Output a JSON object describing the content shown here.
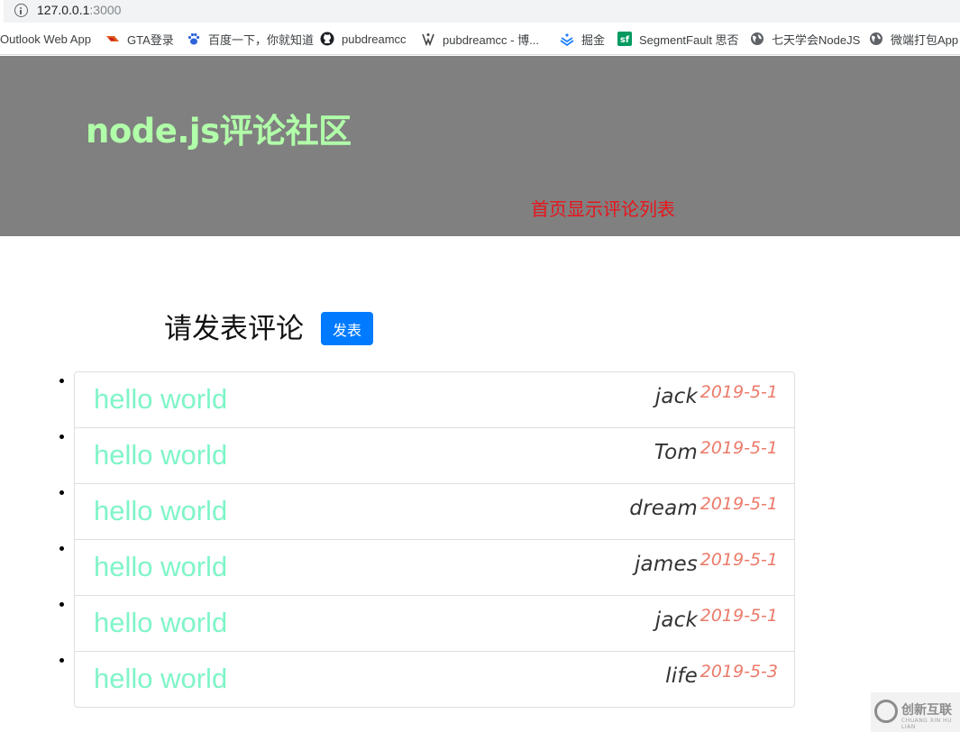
{
  "browser": {
    "url_host": "127.0.0.1",
    "url_port": ":3000",
    "bookmarks": [
      {
        "label": "Outlook Web App",
        "icon": "none"
      },
      {
        "label": "GTA登录",
        "icon": "gta-icon"
      },
      {
        "label": "百度一下，你就知道",
        "icon": "baidu-paw-icon"
      },
      {
        "label": "pubdreamcc",
        "icon": "github-icon"
      },
      {
        "label": "pubdreamcc - 博...",
        "icon": "cnblogs-icon"
      },
      {
        "label": "掘金",
        "icon": "juejin-icon"
      },
      {
        "label": "SegmentFault 思否",
        "icon": "segmentfault-icon"
      },
      {
        "label": "七天学会NodeJS",
        "icon": "globe-icon"
      },
      {
        "label": "微端打包App",
        "icon": "globe-icon"
      }
    ]
  },
  "header": {
    "title": "node.js评论社区",
    "subtitle_link": "首页显示评论列表",
    "title_color": "#b1ffa9",
    "link_color": "#e8151b",
    "background": "#808080"
  },
  "main": {
    "heading": "请发表评论",
    "publish_button": "发表",
    "comments": [
      {
        "text": "hello world",
        "author": "jack",
        "date": "2019-5-1"
      },
      {
        "text": "hello world",
        "author": "Tom",
        "date": "2019-5-1"
      },
      {
        "text": "hello world",
        "author": "dream",
        "date": "2019-5-1"
      },
      {
        "text": "hello world",
        "author": "james",
        "date": "2019-5-1"
      },
      {
        "text": "hello world",
        "author": "jack",
        "date": "2019-5-1"
      },
      {
        "text": "hello world",
        "author": "life",
        "date": "2019-5-3"
      }
    ]
  },
  "watermark": {
    "text": "创新互联",
    "sub": "CHUANG XIN HU LIAN"
  }
}
